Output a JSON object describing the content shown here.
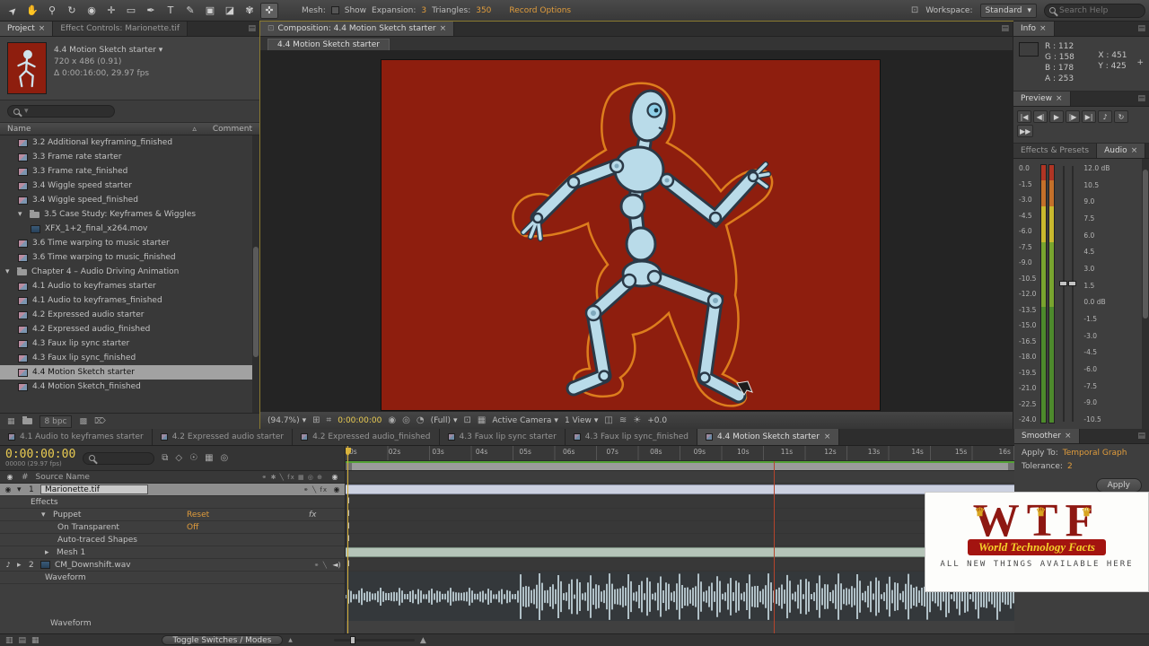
{
  "toolbar": {
    "tools": [
      {
        "name": "selection-tool",
        "glyph": "➤",
        "rot": true
      },
      {
        "name": "hand-tool",
        "glyph": "✋"
      },
      {
        "name": "zoom-tool",
        "glyph": "⚲"
      },
      {
        "name": "rotation-tool",
        "glyph": "↻"
      },
      {
        "name": "unified-camera-tool",
        "glyph": "◉"
      },
      {
        "name": "pan-behind-tool",
        "glyph": "✛"
      },
      {
        "name": "shape-tool",
        "glyph": "▭"
      },
      {
        "name": "pen-tool",
        "glyph": "✒"
      },
      {
        "name": "type-tool",
        "glyph": "T"
      },
      {
        "name": "brush-tool",
        "glyph": "✎"
      },
      {
        "name": "clone-stamp-tool",
        "glyph": "▣"
      },
      {
        "name": "eraser-tool",
        "glyph": "◪"
      },
      {
        "name": "roto-brush-tool",
        "glyph": "✾"
      },
      {
        "name": "puppet-pin-tool",
        "glyph": "✜",
        "selected": true
      }
    ],
    "mesh": {
      "label": "Mesh:",
      "show": "Show",
      "expansion_label": "Expansion:",
      "expansion_value": "3",
      "triangles_label": "Triangles:",
      "triangles_value": "350",
      "record_options": "Record Options"
    },
    "workspace": {
      "label": "Workspace:",
      "value": "Standard"
    },
    "search_placeholder": "Search Help"
  },
  "project": {
    "tab1": "Project",
    "tab2": "Effect Controls: Marionette.tif",
    "selected_item": {
      "title": "4.4 Motion Sketch starter",
      "size": "720 x 486 (0.91)",
      "duration": "Δ 0:00:16:00, 29.97 fps"
    },
    "columns": {
      "name": "Name",
      "comment": "Comment"
    },
    "items": [
      {
        "label": "3.2 Additional keyframing_finished",
        "indent": 1,
        "icon": "comp"
      },
      {
        "label": "3.3 Frame rate starter",
        "indent": 1,
        "icon": "comp"
      },
      {
        "label": "3.3 Frame rate_finished",
        "indent": 1,
        "icon": "comp"
      },
      {
        "label": "3.4 Wiggle speed starter",
        "indent": 1,
        "icon": "comp"
      },
      {
        "label": "3.4 Wiggle speed_finished",
        "indent": 1,
        "icon": "comp"
      },
      {
        "label": "3.5 Case Study: Keyframes & Wiggles",
        "indent": 1,
        "folder": true
      },
      {
        "label": "XFX_1+2_final_x264.mov",
        "indent": 2,
        "icon": "movie"
      },
      {
        "label": "3.6 Time warping to music starter",
        "indent": 1,
        "icon": "comp"
      },
      {
        "label": "3.6 Time warping to music_finished",
        "indent": 1,
        "icon": "comp"
      },
      {
        "label": "Chapter 4 – Audio Driving Animation",
        "indent": 0,
        "folder": true
      },
      {
        "label": "4.1 Audio to keyframes starter",
        "indent": 1,
        "icon": "comp"
      },
      {
        "label": "4.1 Audio to keyframes_finished",
        "indent": 1,
        "icon": "comp"
      },
      {
        "label": "4.2 Expressed audio starter",
        "indent": 1,
        "icon": "comp"
      },
      {
        "label": "4.2 Expressed audio_finished",
        "indent": 1,
        "icon": "comp"
      },
      {
        "label": "4.3 Faux lip sync starter",
        "indent": 1,
        "icon": "comp"
      },
      {
        "label": "4.3 Faux lip sync_finished",
        "indent": 1,
        "icon": "comp"
      },
      {
        "label": "4.4 Motion Sketch starter",
        "indent": 1,
        "icon": "comp",
        "selected": true
      },
      {
        "label": "4.4 Motion Sketch_finished",
        "indent": 1,
        "icon": "comp"
      }
    ],
    "footer_bpc": "8 bpc"
  },
  "composition": {
    "tab": "Composition: 4.4 Motion Sketch starter",
    "subtab": "4.4 Motion Sketch starter",
    "status": {
      "zoom": "(94.7%)",
      "timecode": "0:00:00:00",
      "resolution": "(Full)",
      "camera": "Active Camera",
      "views": "1 View",
      "exposure": "+0.0"
    }
  },
  "info": {
    "tab": "Info",
    "r": "R : 112",
    "g": "G : 158",
    "b": "B : 178",
    "a": "A : 253",
    "x": "X : 451",
    "y": "Y : 425",
    "swatch_color": "#9fcde0"
  },
  "preview": {
    "tab": "Preview",
    "buttons": [
      {
        "name": "first-frame",
        "glyph": "|◀"
      },
      {
        "name": "previous-frame",
        "glyph": "◀|"
      },
      {
        "name": "play",
        "glyph": "▶"
      },
      {
        "name": "next-frame",
        "glyph": "|▶"
      },
      {
        "name": "last-frame",
        "glyph": "▶|"
      },
      {
        "name": "audio-mute",
        "glyph": "♪"
      },
      {
        "name": "loop",
        "glyph": "↻"
      },
      {
        "name": "ram-preview",
        "glyph": "▶▶"
      }
    ]
  },
  "audio": {
    "tab1": "Effects & Presets",
    "tab2": "Audio",
    "left_scale": [
      "0.0",
      "-1.5",
      "-3.0",
      "-4.5",
      "-6.0",
      "-7.5",
      "-9.0",
      "-10.5",
      "-12.0",
      "-13.5",
      "-15.0",
      "-16.5",
      "-18.0",
      "-19.5",
      "-21.0",
      "-22.5",
      "-24.0"
    ],
    "right_scale": [
      "12.0 dB",
      "10.5",
      "9.0",
      "7.5",
      "6.0",
      "4.5",
      "3.0",
      "1.5",
      "0.0 dB",
      "-1.5",
      "-3.0",
      "-4.5",
      "-6.0",
      "-7.5",
      "-9.0",
      "-10.5"
    ]
  },
  "smoother": {
    "tab": "Smoother",
    "apply_to_label": "Apply To:",
    "apply_to_value": "Temporal Graph",
    "tolerance_label": "Tolerance:",
    "tolerance_value": "2",
    "apply_button": "Apply"
  },
  "timeline": {
    "tabs": [
      {
        "label": "4.1 Audio to keyframes starter"
      },
      {
        "label": "4.2 Expressed audio starter"
      },
      {
        "label": "4.2 Expressed audio_finished"
      },
      {
        "label": "4.3 Faux lip sync starter"
      },
      {
        "label": "4.3 Faux lip sync_finished"
      },
      {
        "label": "4.4 Motion Sketch starter",
        "active": true
      }
    ],
    "timecode": "0:00:00:00",
    "frame_info": "00000 (29.97 fps)",
    "ruler": [
      "0s",
      "02s",
      "03s",
      "04s",
      "05s",
      "06s",
      "07s",
      "08s",
      "09s",
      "10s",
      "11s",
      "12s",
      "13s",
      "14s",
      "15s",
      "16s"
    ],
    "header": {
      "hash": "#",
      "source": "Source Name"
    },
    "rows": {
      "layer1": {
        "num": "1",
        "name": "Marionette.tif"
      },
      "effects": "Effects",
      "puppet": {
        "label": "Puppet",
        "value": "Reset",
        "fx": "fx"
      },
      "on_transparent": {
        "label": "On Transparent",
        "value": "Off"
      },
      "auto_traced": "Auto-traced Shapes",
      "mesh": "Mesh 1",
      "layer2": {
        "num": "2",
        "name": "CM_Downshift.wav"
      },
      "waveform1": "Waveform",
      "waveform2": "Waveform"
    },
    "toggle_button": "Toggle Switches / Modes"
  },
  "watermark": {
    "letters": "WTF",
    "banner": "World Technology Facts",
    "tagline": "ALL NEW THINGS AVAILABLE HERE"
  }
}
